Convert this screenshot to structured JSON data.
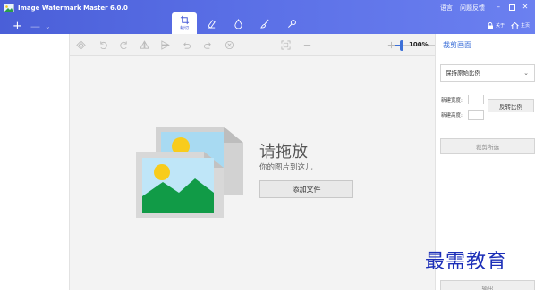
{
  "window": {
    "title": "Image Watermark Master 6.0.0",
    "links": [
      "语言",
      "问题反馈"
    ],
    "controls": [
      "minimize",
      "maximize",
      "close"
    ]
  },
  "header": {
    "add_label": "+",
    "remove_label": "—",
    "chevron_label": "⌄",
    "tools": [
      {
        "name": "crop",
        "label": "裁切",
        "active": true
      },
      {
        "name": "erase",
        "label": ""
      },
      {
        "name": "water",
        "label": ""
      },
      {
        "name": "brush",
        "label": ""
      },
      {
        "name": "pin",
        "label": ""
      }
    ],
    "about_label": "关于",
    "home_label": "主页"
  },
  "edit_toolbar": {
    "zoom_level": "100%",
    "zoom_value": 0.15,
    "icons": [
      "diamond-icon",
      "rotate-left-icon",
      "rotate-right-icon",
      "flip-horizontal-icon",
      "flip-vertical-icon",
      "undo-icon",
      "redo-icon",
      "reset-icon",
      "fit-screen-icon",
      "zoom-out-icon",
      "zoom-in-icon"
    ]
  },
  "canvas": {
    "drop_title": "请拖放",
    "drop_subtitle": "你的图片到这儿",
    "add_file_label": "添加文件"
  },
  "right_panel": {
    "title": "裁剪画面",
    "aspect_value": "保持原始比例",
    "new_width_label": "新建宽度:",
    "new_height_label": "新建高度:",
    "reverse_label": "反转比例",
    "crop_selection_label": "裁剪所选",
    "output_label": "输出"
  },
  "watermark": "最需教育",
  "colors": {
    "titlebar": "#5468e0",
    "accent": "#3b6fd8",
    "panel_bg": "#f3f3f3"
  }
}
